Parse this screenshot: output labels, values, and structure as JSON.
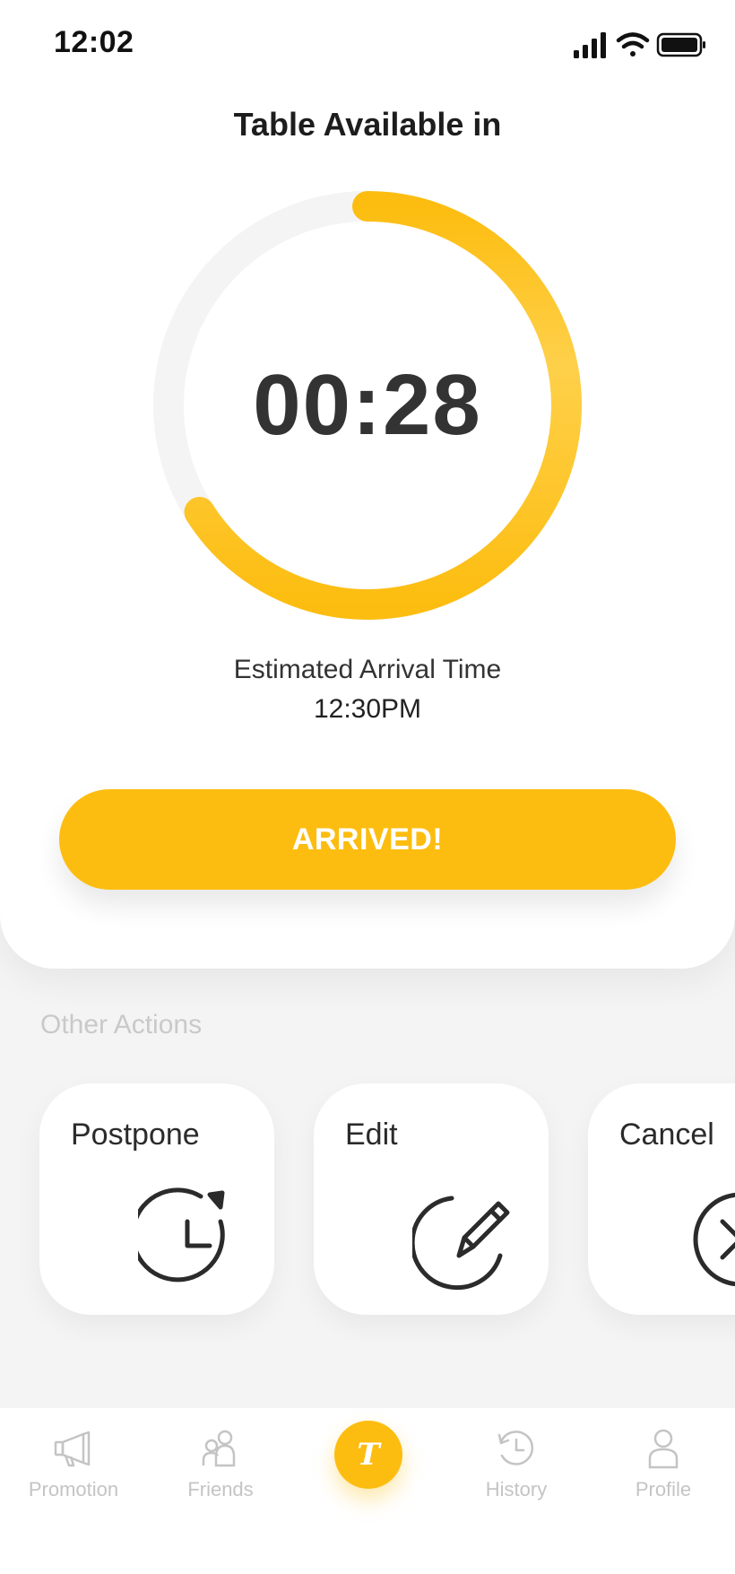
{
  "status_bar": {
    "time": "12:02",
    "icons": [
      "signal-icon",
      "wifi-icon",
      "battery-icon"
    ]
  },
  "title": "Table Available in",
  "timer": {
    "value": "00:28",
    "progress_fraction": 0.66,
    "track_color": "#f4f4f4",
    "progress_color": "#fdbd10"
  },
  "eta": {
    "label": "Estimated Arrival Time",
    "value": "12:30PM"
  },
  "primary_action": {
    "label": "ARRIVED!",
    "color": "#fdbd10"
  },
  "other_actions": {
    "section_label": "Other Actions",
    "items": [
      {
        "label": "Postpone",
        "icon": "postpone-clock-icon"
      },
      {
        "label": "Edit",
        "icon": "edit-pencil-icon"
      },
      {
        "label": "Cancel",
        "icon": "cancel-icon"
      }
    ]
  },
  "bottom_nav": {
    "items": [
      {
        "label": "Promotion",
        "icon": "megaphone-icon"
      },
      {
        "label": "Friends",
        "icon": "friends-icon"
      },
      {
        "label": "T",
        "icon": "home-logo-icon",
        "active": true
      },
      {
        "label": "History",
        "icon": "history-icon"
      },
      {
        "label": "Profile",
        "icon": "profile-icon"
      }
    ],
    "inactive_color": "#c4c4c4",
    "active_color": "#fdbd10"
  }
}
